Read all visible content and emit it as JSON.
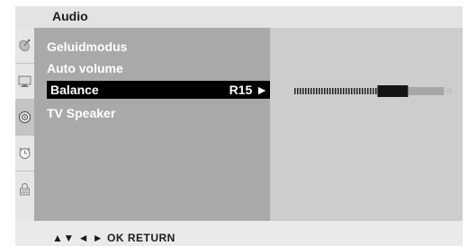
{
  "header": {
    "title": "Audio"
  },
  "sidebar": {
    "icons": [
      "satellite-dish-icon",
      "monitor-icon",
      "speaker-icon",
      "clock-icon",
      "lock-icon"
    ],
    "active_index": 2
  },
  "menu": {
    "items": [
      {
        "label": "Geluidmodus",
        "value": ""
      },
      {
        "label": "Auto volume",
        "value": ""
      },
      {
        "label": "Balance",
        "value": "R15 ►",
        "selected": true
      },
      {
        "label": "TV Speaker",
        "value": ""
      }
    ]
  },
  "balance": {
    "value": 15,
    "min": -50,
    "max": 50
  },
  "footer": {
    "hint": "▲▼  ◄ ►  OK  RETURN"
  },
  "colors": {
    "menu_bg": "#a9a9a9",
    "selection_bg": "#000000",
    "detail_bg": "#cdcdcd",
    "header_bg": "#e3e3e3"
  }
}
